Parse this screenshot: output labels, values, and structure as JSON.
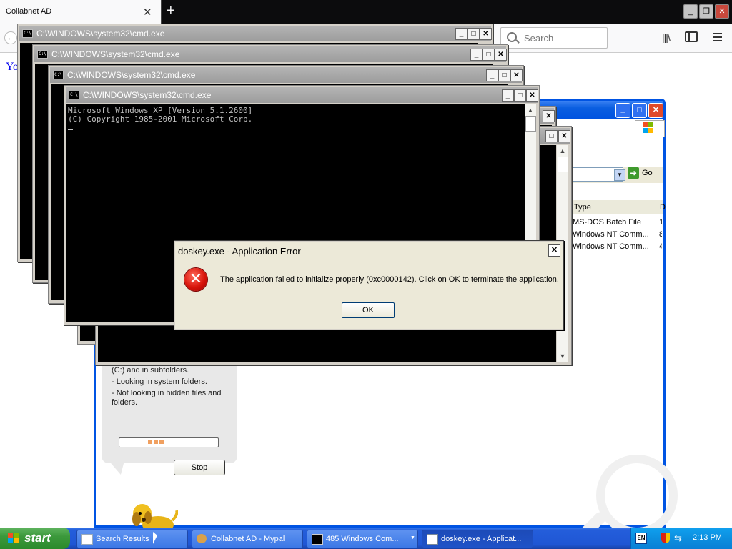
{
  "firefox": {
    "tab_title": "Collabnet AD",
    "search_placeholder": "Search",
    "page_link_text": "Yo"
  },
  "search_window": {
    "address_go": "Go",
    "columns": [
      "Type",
      "D"
    ],
    "rows": [
      {
        "type": "MS-DOS Batch File",
        "d": "1"
      },
      {
        "type": "Windows NT Comm...",
        "d": "8"
      },
      {
        "type": "Windows NT Comm...",
        "d": "4"
      }
    ],
    "status_lines": [
      "(C:) and in subfolders.",
      "- Looking in system folders.",
      "- Not looking in hidden files and folders."
    ],
    "stop_label": "Stop",
    "scroll_thumb_grip": "|||"
  },
  "cmd_windows": [
    {
      "title": "C:\\WINDOWS\\system32\\cmd.exe"
    },
    {
      "title": "C:\\WINDOWS\\system32\\cmd.exe"
    },
    {
      "title": "C:\\WINDOWS\\system32\\cmd.exe"
    },
    {
      "title": "C:\\WINDOWS\\system32\\cmd.exe"
    }
  ],
  "cmd_output": "Microsoft Windows XP [Version 5.1.2600]\n(C) Copyright 1985-2001 Microsoft Corp.",
  "error_dialog": {
    "title": "doskey.exe - Application Error",
    "message": "The application failed to initialize properly (0xc0000142). Click on OK to terminate the application.",
    "ok_label": "OK"
  },
  "taskbar": {
    "start_label": "start",
    "items": [
      {
        "label": "Search Results",
        "icon": "search-results-icon"
      },
      {
        "label": "Collabnet AD - Mypal",
        "icon": "browser-icon"
      },
      {
        "label": "485 Windows Com...",
        "icon": "cmd-icon"
      },
      {
        "label": "doskey.exe - Applicat...",
        "icon": "window-icon"
      }
    ],
    "clock": "2:13 PM",
    "lang": "EN"
  },
  "colors": {
    "xp_blue": "#245edb",
    "start_green": "#3c993c",
    "error_red": "#d8140a",
    "link_blue": "#0000ee"
  }
}
